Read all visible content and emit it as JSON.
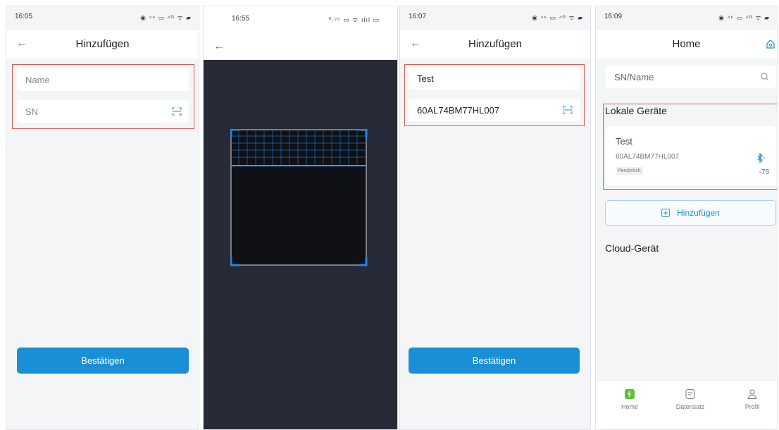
{
  "screen1": {
    "time": "16:05",
    "status_icons": "◉ ⁴⁶ ▭ ⁴ᴳ ᯤ ▰",
    "back": "←",
    "title": "Hinzufügen",
    "name_placeholder": "Name",
    "sn_placeholder": "SN",
    "confirm": "Bestätigen"
  },
  "screen2": {
    "time": "16:55",
    "status_icons": "⁰·²⁵ ▭ ᯤ ılıl ▭",
    "back": "←"
  },
  "screen3": {
    "time": "16:07",
    "status_icons": "◉ ⁴⁶ ▭ ⁴ᴳ ᯤ ▰",
    "back": "←",
    "title": "Hinzufügen",
    "name_value": "Test",
    "sn_value": "60AL74BM77HL007",
    "confirm": "Bestätigen"
  },
  "screen4": {
    "time": "16:09",
    "status_icons": "◉ ⁴⁶ ▭ ⁴ᴳ ᯤ ▰",
    "title": "Home",
    "search_placeholder": "SN/Name",
    "local_devices": "Lokale Geräte",
    "device": {
      "name": "Test",
      "sn": "60AL74BM77HL007",
      "tag": "Persönlich",
      "rssi": "-75"
    },
    "add_button": "Hinzufügen",
    "cloud_devices": "Cloud-Gerät",
    "tabs": [
      "Home",
      "Datensatz",
      "Profil"
    ]
  },
  "colors": {
    "accent": "#1a8fd6",
    "highlight": "#e05a4a",
    "scan_frame": "#1e88e5",
    "green_tab": "#5bc236"
  }
}
